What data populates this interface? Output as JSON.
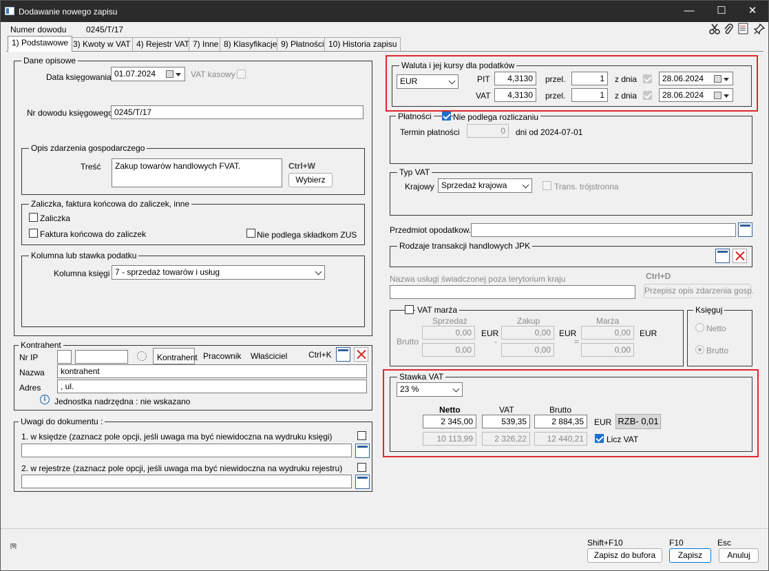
{
  "window": {
    "title": "Dodawanie nowego zapisu",
    "minimize": "—",
    "maximize": "☐",
    "close": "✕"
  },
  "header": {
    "doc_label": "Numer dowodu",
    "doc_value": "0245/T/17"
  },
  "tabs": [
    "1) Podstawowe",
    "3) Kwoty w VAT",
    "4) Rejestr VAT",
    "7) Inne",
    "8) Klasyfikacje",
    "9) Płatności",
    "10) Historia zapisu"
  ],
  "dane_opisowe": {
    "title": "Dane opisowe",
    "data_label": "Data księgowania",
    "data_value": "01.07.2024",
    "vat_kasowy": "VAT kasowy",
    "nr_label": "Nr dowodu księgowego",
    "nr_value": "0245/T/17"
  },
  "opis": {
    "title": "Opis zdarzenia gospodarczego",
    "tresc_label": "Treść",
    "tresc_value": "Zakup towarów handlowych FVAT.",
    "shortcut": "Ctrl+W",
    "wybierz": "Wybierz"
  },
  "zaliczka": {
    "title": "Zaliczka, faktura końcowa do zaliczek, inne",
    "zaliczka": "Zaliczka",
    "faktura": "Faktura końcowa do zaliczek",
    "zus": "Nie podlega składkom ZUS"
  },
  "kolumna": {
    "title": "Kolumna lub stawka podatku",
    "label": "Kolumna księgi",
    "value": "7   - sprzedaż towarów i usług"
  },
  "kontrahent": {
    "title": "Kontrahent",
    "nrip_label": "Nr IP",
    "tab1": "Kontrahent",
    "tab2": "Pracownik",
    "tab3": "Właściciel",
    "shortcut": "Ctrl+K",
    "nazwa_label": "Nazwa",
    "nazwa_value": "kontrahent",
    "adres_label": "Adres",
    "adres_value": ", ul.",
    "info_icon": "i",
    "info": "Jednostka nadrzędna : nie wskazano"
  },
  "uwagi": {
    "title": "Uwagi do dokumentu :",
    "w_ksiedze": "1. w księdze (zaznacz pole opcji, jeśli uwaga ma być niewidoczna na wydruku księgi)",
    "w_rejestrze": "2. w rejestrze (zaznacz pole opcji, jeśli uwaga ma być niewidoczna na wydruku rejestru)"
  },
  "waluta": {
    "title": "Waluta i jej kursy dla podatków",
    "currency": "EUR",
    "pit_label": "PIT",
    "pit_rate": "4,3130",
    "przel_label": "przel.",
    "pit_przel": "1",
    "zdnia_label": "z dnia",
    "pit_date": "28.06.2024",
    "vat_label": "VAT",
    "vat_rate": "4,3130",
    "vat_przel": "1",
    "vat_date": "28.06.2024"
  },
  "platnosci": {
    "title": "Płatności",
    "nie_podlega": "Nie podlega rozliczaniu",
    "termin_label": "Termin płatności",
    "termin_value": "0",
    "dni_od": "dni od 2024-07-01"
  },
  "typ_vat": {
    "title": "Typ VAT",
    "krajowy_label": "Krajowy",
    "value": "Sprzedaż krajowa",
    "trans": "Trans. trójstronna"
  },
  "przedmiot": {
    "label": "Przedmiot opodatkow."
  },
  "jpk": {
    "title": "Rodzaje transakcji handlowych JPK"
  },
  "nazwa_uslugi": {
    "label": "Nazwa usługi świadczonej poza terytorium kraju",
    "shortcut": "Ctrl+D",
    "btn": "Przepisz opis zdarzenia gosp."
  },
  "vat_marza": {
    "title": "VAT marża",
    "sprzedaz": "Sprzedaż",
    "zakup": "Zakup",
    "marza": "Marża",
    "brutto": "Brutto",
    "s1": "0,00",
    "s2": "0,00",
    "z1": "0,00",
    "z2": "0,00",
    "m1": "0,00",
    "m2": "0,00",
    "cur": "EUR",
    "minus": "-",
    "eq": "="
  },
  "ksieguj": {
    "title": "Księguj",
    "netto": "Netto",
    "brutto": "Brutto"
  },
  "stawka": {
    "title": "Stawka VAT",
    "value": "23 %",
    "netto_h": "Netto",
    "vat_h": "VAT",
    "brutto_h": "Brutto",
    "netto": "2 345,00",
    "vat": "539,35",
    "brutto": "2 884,35",
    "cur": "EUR",
    "rzb": "RZB- 0,01",
    "netto_pln": "10 113,99",
    "vat_pln": "2 326,22",
    "brutto_pln": "12 440,21",
    "licz_vat": "Licz VAT"
  },
  "footer": {
    "code": "[9]",
    "sc1": "Shift+F10",
    "sc2": "F10",
    "sc3": "Esc",
    "b1": "Zapisz do bufora",
    "b2": "Zapisz",
    "b3": "Anuluj"
  },
  "colors": {
    "highlight": "#e0262e",
    "check": "#1f6fd1"
  }
}
